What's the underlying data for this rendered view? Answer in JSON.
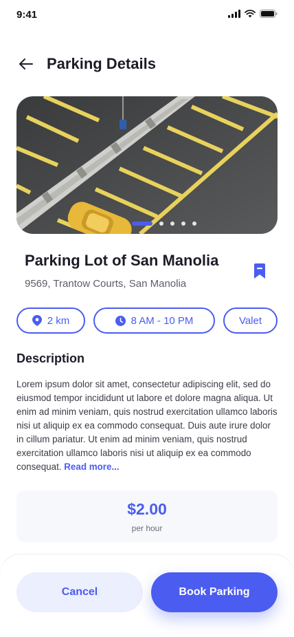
{
  "status_bar": {
    "time": "9:41"
  },
  "header": {
    "title": "Parking Details",
    "back_icon": "arrow-left-icon"
  },
  "gallery": {
    "total_images": 5,
    "active_index": 0
  },
  "lot": {
    "name": "Parking Lot of San Manolia",
    "address": "9569, Trantow Courts, San Manolia",
    "bookmarked": true
  },
  "chips": [
    {
      "icon": "location-pin-icon",
      "label": "2 km"
    },
    {
      "icon": "clock-icon",
      "label": "8 AM - 10 PM"
    },
    {
      "icon": "",
      "label": "Valet"
    }
  ],
  "description": {
    "title": "Description",
    "text": "Lorem ipsum dolor sit amet, consectetur adipiscing elit, sed do eiusmod tempor incididunt ut labore et dolore magna aliqua. Ut enim ad minim veniam, quis nostrud exercitation ullamco laboris nisi ut aliquip ex ea commodo consequat. Duis aute irure dolor in cillum pariatur. Ut enim ad minim veniam, quis nostrud exercitation ullamco laboris nisi ut aliquip ex ea commodo consequat.",
    "read_more": "Read more..."
  },
  "price": {
    "amount": "$2.00",
    "unit": "per hour"
  },
  "actions": {
    "cancel_label": "Cancel",
    "book_label": "Book Parking"
  },
  "colors": {
    "accent": "#4b5cf0",
    "accent_light": "#eceffd",
    "text": "#1c1c27"
  }
}
